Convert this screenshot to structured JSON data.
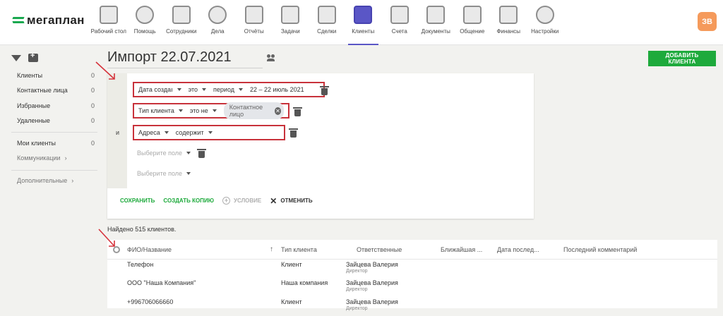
{
  "app": {
    "logo": "мегаплан",
    "avatar_initials": "ЗВ",
    "accent": "#5a56c6",
    "brand_green": "#1eaa3c"
  },
  "nav": [
    {
      "label": "Рабочий стол",
      "icon": "dashboard-icon"
    },
    {
      "label": "Помощь",
      "icon": "lifebuoy-icon"
    },
    {
      "label": "Сотрудники",
      "icon": "employees-icon"
    },
    {
      "label": "Дела",
      "icon": "clock-icon"
    },
    {
      "label": "Отчёты",
      "icon": "chart-icon"
    },
    {
      "label": "Задачи",
      "icon": "clipboard-icon"
    },
    {
      "label": "Сделки",
      "icon": "briefcase-icon"
    },
    {
      "label": "Клиенты",
      "icon": "contacts-book-icon",
      "active": true
    },
    {
      "label": "Счета",
      "icon": "invoice-icon"
    },
    {
      "label": "Документы",
      "icon": "folder-icon"
    },
    {
      "label": "Общение",
      "icon": "chat-icon"
    },
    {
      "label": "Финансы",
      "icon": "safe-icon"
    },
    {
      "label": "Настройки",
      "icon": "gear-icon"
    }
  ],
  "sidebar": {
    "items": [
      {
        "label": "Клиенты",
        "count": "0"
      },
      {
        "label": "Контактные лица",
        "count": "0"
      },
      {
        "label": "Избранные",
        "count": "0"
      },
      {
        "label": "Удаленные",
        "count": "0"
      }
    ],
    "my_clients": {
      "label": "Мои клиенты",
      "count": "0"
    },
    "communications": "Коммуникации",
    "additional": "Дополнительные"
  },
  "page": {
    "title": "Импорт 22.07.2021",
    "add_button": "ДОБАВИТЬ КЛИЕНТА"
  },
  "filter": {
    "and_label": "и",
    "rows": [
      {
        "field": "Дата создаı",
        "op": "это",
        "mode": "период",
        "value": "22 – 22 июль 2021"
      },
      {
        "field": "Тип клиента",
        "op": "это не",
        "chip": "Контактное лицо"
      },
      {
        "field": "Адреса",
        "op": "содержит"
      }
    ],
    "empty_1": "Выберите поле",
    "empty_2": "Выберите поле",
    "actions": {
      "save": "СОХРАНИТЬ",
      "copy": "СОЗДАТЬ КОПИЮ",
      "condition": "УСЛОВИЕ",
      "cancel": "ОТМЕНИТЬ"
    }
  },
  "results": {
    "found": "Найдено 515 клиентов.",
    "columns": [
      "ФИО/Название",
      "Тип клиента",
      "Ответственные",
      "Ближайшая ...",
      "Дата послед...",
      "Последний комментарий"
    ],
    "rows": [
      {
        "name": "Телефон",
        "type": "Клиент",
        "resp": "Зайцева Валерия",
        "role": "Директор"
      },
      {
        "name": "ООО \"Наша Компания\"",
        "type": "Наша компания",
        "resp": "Зайцева Валерия",
        "role": "Директор"
      },
      {
        "name": "+996706066660",
        "type": "Клиент",
        "resp": "Зайцева Валерия",
        "role": "Директор"
      }
    ]
  }
}
